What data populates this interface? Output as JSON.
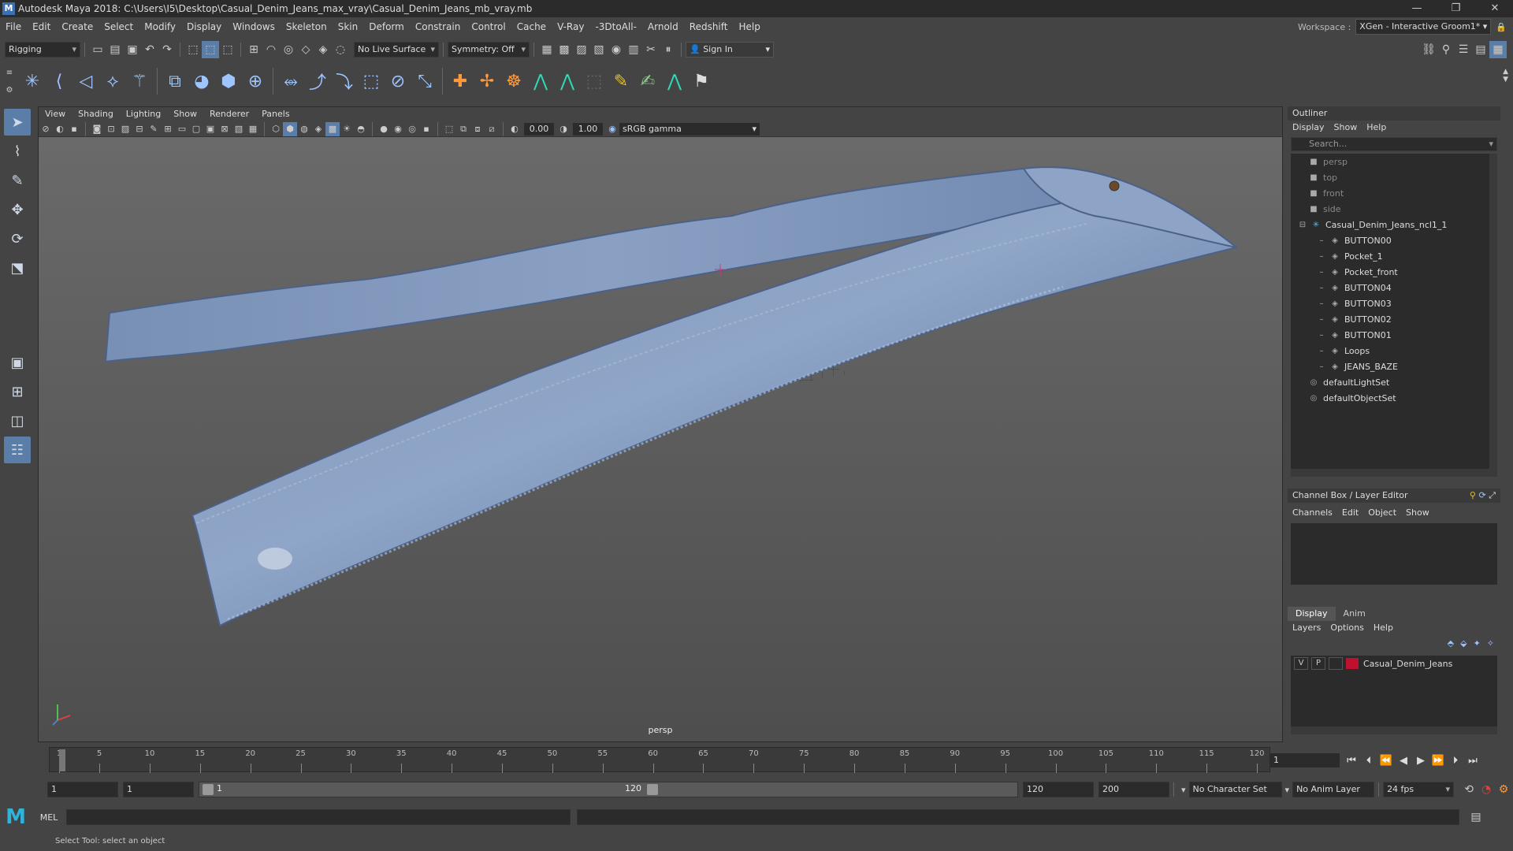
{
  "window": {
    "title": "Autodesk Maya 2018: C:\\Users\\I5\\Desktop\\Casual_Denim_Jeans_max_vray\\Casual_Denim_Jeans_mb_vray.mb",
    "minimize": "—",
    "restore": "❐",
    "close": "✕"
  },
  "menus": [
    "File",
    "Edit",
    "Create",
    "Select",
    "Modify",
    "Display",
    "Windows",
    "Skeleton",
    "Skin",
    "Deform",
    "Constrain",
    "Control",
    "Cache",
    "V-Ray",
    "-3DtoAll-",
    "Arnold",
    "Redshift",
    "Help"
  ],
  "workspace": {
    "label": "Workspace :",
    "value": "XGen - Interactive Groom1*"
  },
  "status": {
    "mode": "Rigging",
    "live_surface": "No Live Surface",
    "symmetry": "Symmetry: Off",
    "sign_in": "Sign In"
  },
  "viewport": {
    "menus": [
      "View",
      "Shading",
      "Lighting",
      "Show",
      "Renderer",
      "Panels"
    ],
    "exposure": "0.00",
    "gamma_value": "1.00",
    "color_space": "sRGB gamma",
    "camera": "persp"
  },
  "outliner": {
    "title": "Outliner",
    "menus": [
      "Display",
      "Show",
      "Help"
    ],
    "search_placeholder": "Search...",
    "items": [
      {
        "label": "persp",
        "kind": "camera",
        "indent": 1
      },
      {
        "label": "top",
        "kind": "camera",
        "indent": 1
      },
      {
        "label": "front",
        "kind": "camera",
        "indent": 1
      },
      {
        "label": "side",
        "kind": "camera",
        "indent": 1
      },
      {
        "label": "Casual_Denim_Jeans_ncl1_1",
        "kind": "group",
        "indent": 0
      },
      {
        "label": "BUTTON00",
        "kind": "mesh",
        "indent": 2
      },
      {
        "label": "Pocket_1",
        "kind": "mesh",
        "indent": 2
      },
      {
        "label": "Pocket_front",
        "kind": "mesh",
        "indent": 2
      },
      {
        "label": "BUTTON04",
        "kind": "mesh",
        "indent": 2
      },
      {
        "label": "BUTTON03",
        "kind": "mesh",
        "indent": 2
      },
      {
        "label": "BUTTON02",
        "kind": "mesh",
        "indent": 2
      },
      {
        "label": "BUTTON01",
        "kind": "mesh",
        "indent": 2
      },
      {
        "label": "Loops",
        "kind": "mesh",
        "indent": 2
      },
      {
        "label": "JEANS_BAZE",
        "kind": "mesh",
        "indent": 2
      },
      {
        "label": "defaultLightSet",
        "kind": "set",
        "indent": 1
      },
      {
        "label": "defaultObjectSet",
        "kind": "set",
        "indent": 1
      }
    ]
  },
  "channel_box": {
    "title": "Channel Box / Layer Editor",
    "menus": [
      "Channels",
      "Edit",
      "Object",
      "Show"
    ]
  },
  "layer_editor": {
    "tabs": [
      "Display",
      "Anim"
    ],
    "menus": [
      "Layers",
      "Options",
      "Help"
    ],
    "layer": {
      "v": "V",
      "p": "P",
      "name": "Casual_Denim_Jeans",
      "color": "#c0102f"
    }
  },
  "timeline": {
    "ticks": [
      "1",
      "5",
      "10",
      "15",
      "20",
      "25",
      "30",
      "35",
      "40",
      "45",
      "50",
      "55",
      "60",
      "65",
      "70",
      "75",
      "80",
      "85",
      "90",
      "95",
      "100",
      "105",
      "110",
      "115",
      "120"
    ],
    "current_frame": "1"
  },
  "range": {
    "start": "1",
    "playback_start": "1",
    "slider_start": "1",
    "slider_end": "120",
    "playback_end": "120",
    "end": "200",
    "character_set": "No Character Set",
    "anim_layer": "No Anim Layer",
    "fps": "24 fps"
  },
  "command": {
    "label": "MEL"
  },
  "help_line": "Select Tool: select an object"
}
